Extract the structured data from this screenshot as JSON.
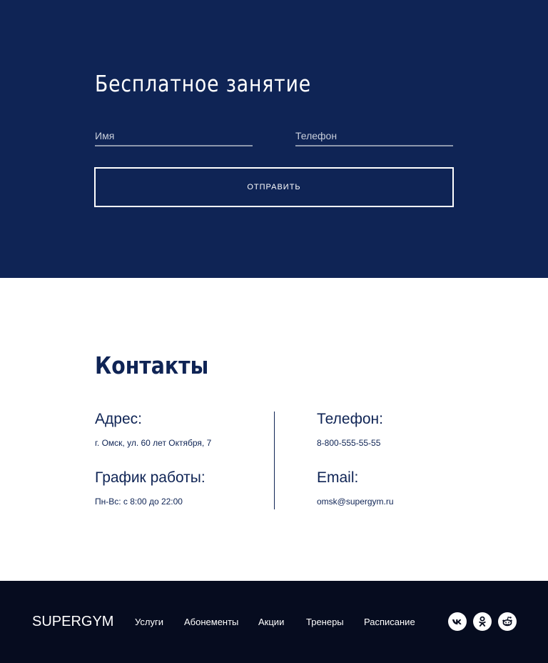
{
  "signup": {
    "title": "Бесплатное занятие",
    "name_placeholder": "Имя",
    "phone_placeholder": "Телефон",
    "submit_label": "ОТПРАВИТЬ"
  },
  "contacts": {
    "title": "Контакты",
    "address_label": "Адрес:",
    "address_value": "г. Омск, ул. 60 лет Октября, 7",
    "hours_label": "График работы:",
    "hours_value": "Пн-Вс: с 8:00 до 22:00",
    "phone_label": "Телефон:",
    "phone_value": "8-800-555-55-55",
    "email_label": "Email:",
    "email_value": "omsk@supergym.ru"
  },
  "footer": {
    "logo": "SUPERGYM",
    "nav": [
      "Услуги",
      "Абонементы",
      "Акции",
      "Тренеры",
      "Расписание"
    ],
    "social_icons": [
      "vk-icon",
      "odnoklassniki-icon",
      "reddit-icon"
    ]
  },
  "colors": {
    "navy": "#0f2455",
    "footer_bg": "#060c1f",
    "white": "#ffffff"
  }
}
